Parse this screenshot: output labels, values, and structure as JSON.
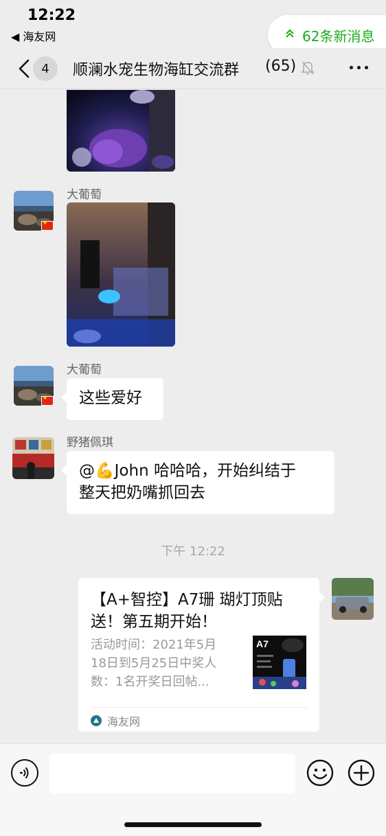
{
  "status_bar": {
    "time": "12:22",
    "back_app": "◀ 海友网"
  },
  "new_messages": {
    "label": "62条新消息",
    "color": "#1aad19"
  },
  "nav": {
    "unread_count": "4",
    "title": "顺澜水宠生物海缸交流群",
    "member_count": "(65)"
  },
  "messages": [
    {
      "type": "image",
      "sender": "",
      "description": "coral photo (partially visible)"
    },
    {
      "type": "image",
      "sender": "大葡萄",
      "description": "aquarium equipment photo"
    },
    {
      "type": "text",
      "sender": "大葡萄",
      "text": "这些爱好"
    },
    {
      "type": "text",
      "sender": "野猪佩琪",
      "lines": [
        "@💪John 哈哈哈，开始纠结于",
        "整天把奶嘴抓回去"
      ]
    }
  ],
  "timestamp": "下午 12:22",
  "link_card": {
    "title_lines": [
      "【A+智控】A7珊 瑚灯顶贴",
      "送！第五期开始！"
    ],
    "desc_lines": [
      "活动时间：2021年5月",
      "18日到5月25日中奖人",
      "数：1名开奖日回帖..."
    ],
    "thumb_label": "A7",
    "source": "海友网"
  },
  "input": {
    "placeholder": ""
  }
}
